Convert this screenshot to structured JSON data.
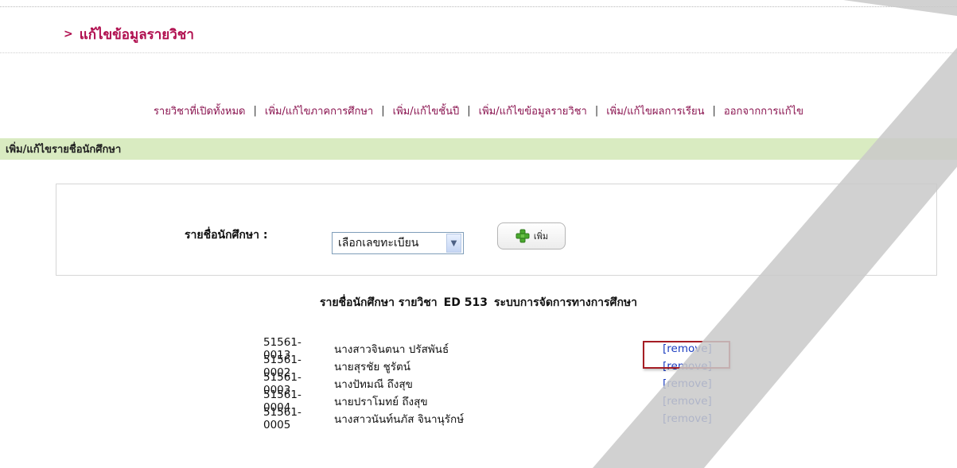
{
  "header": {
    "arrow": ">",
    "title": "แก้ไขข้อมูลรายวิชา"
  },
  "menu": {
    "items": [
      "รายวิชาที่เปิดทั้งหมด",
      "เพิ่ม/แก้ไขภาคการศึกษา",
      "เพิ่ม/แก้ไขชั้นปี",
      "เพิ่ม/แก้ไขข้อมูลรายวิชา",
      "เพิ่ม/แก้ไขผลการเรียน",
      "ออกจากการแก้ไข"
    ],
    "separator": "|"
  },
  "section": {
    "title": "เพิ่ม/แก้ไขรายชื่อนักศึกษา"
  },
  "form": {
    "label": "รายชื่อนักศึกษา :",
    "select_value": "เลือกเลขทะเบียน",
    "add_label": "เพิ่ม"
  },
  "list": {
    "title_prefix": "รายชื่อนักศึกษา รายวิชา",
    "course_code": "ED 513",
    "course_name": "ระบบการจัดการทางการศึกษา",
    "students": [
      {
        "id": "51561-0013",
        "name": "นางสาวจินตนา ปรัสพันธ์",
        "action": "[remove]"
      },
      {
        "id": "51561-0002",
        "name": "นายสุรชัย ชูรัตน์",
        "action": "[remove]"
      },
      {
        "id": "51561-0003",
        "name": "นางปัทมณี ถึงสุข",
        "action": "[remove]"
      },
      {
        "id": "51561-0004",
        "name": "นายปราโมทย์ ถึงสุข",
        "action": "[remove]"
      },
      {
        "id": "51561-0005",
        "name": "นางสาวนันท์นภัส จินานุรักษ์",
        "action": "[remove]"
      }
    ]
  },
  "colors": {
    "title": "#b00f4f",
    "menu_link": "#8a1450",
    "section_bar": "#d9ebc1",
    "remove_link": "#1a3cc0",
    "highlight_box": "#a51d24"
  },
  "icons": {
    "add": "plus-icon",
    "dropdown": "chevron-down-icon"
  }
}
